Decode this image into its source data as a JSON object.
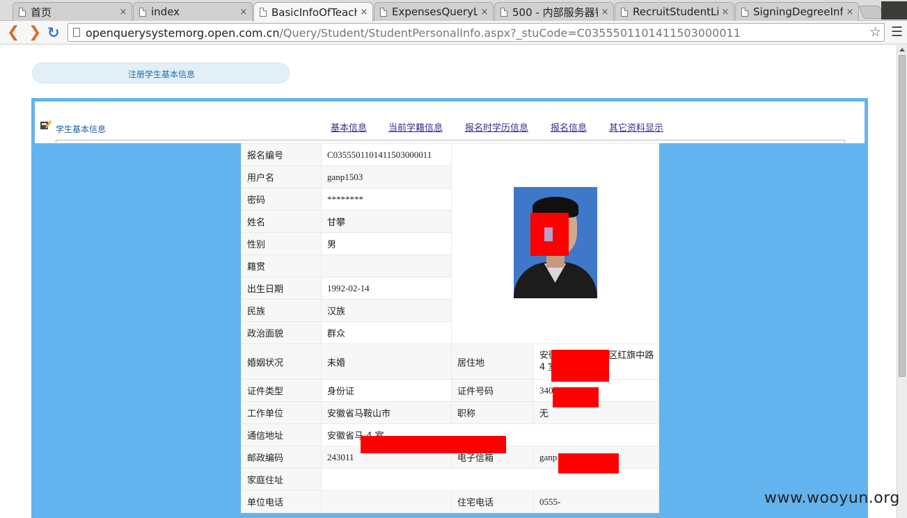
{
  "browser": {
    "tabs": [
      {
        "title": "首页",
        "active": false
      },
      {
        "title": "index",
        "active": false
      },
      {
        "title": "BasicInfoOfTeach",
        "active": true
      },
      {
        "title": "ExpensesQueryLi",
        "active": false
      },
      {
        "title": "500 - 内部服务器错",
        "active": false
      },
      {
        "title": "RecruitStudentLis",
        "active": false
      },
      {
        "title": "SigningDegreeInf",
        "active": false
      }
    ],
    "close_glyph": "×",
    "url_host": "openquerysystemorg.open.com.cn",
    "url_path": "/Query/Student/StudentPersonalInfo.aspx?_stuCode=C0355501101411503000011"
  },
  "page": {
    "register_link": "注册学生基本信息",
    "section_title": "学生基本信息",
    "tabs": [
      "基本信息",
      "当前学籍信息",
      "报名时学历信息",
      "报名信息",
      "其它资料显示"
    ]
  },
  "student": {
    "rows_top": [
      {
        "label": "报名编号",
        "value": "C0355501101411503000011"
      },
      {
        "label": "用户名",
        "value": "ganp1503"
      },
      {
        "label": "密码",
        "value": "********"
      },
      {
        "label": "姓名",
        "value": "甘攀"
      },
      {
        "label": "性别",
        "value": "男"
      },
      {
        "label": "籍贯",
        "value": ""
      },
      {
        "label": "出生日期",
        "value": "1992-02-14"
      },
      {
        "label": "民族",
        "value": "汉族"
      },
      {
        "label": "政治面貌",
        "value": "群众"
      }
    ],
    "rows_bottom": [
      {
        "label": "婚姻状况",
        "value": "未婚",
        "label2": "居住地",
        "value2": "安徽 马鞍山 雨山区红旗中路 4 室"
      },
      {
        "label": "证件类型",
        "value": "身份证",
        "label2": "证件号码",
        "value2": "340 40215"
      },
      {
        "label": "工作单位",
        "value": "安徽省马鞍山市",
        "label2": "职称",
        "value2": "无"
      },
      {
        "label": "通信地址",
        "value": "安徽省马 4 室"
      },
      {
        "label": "邮政编码",
        "value": "243011",
        "label2": "电子信箱",
        "value2": "ganp .cn"
      },
      {
        "label": "家庭住址",
        "value": ""
      },
      {
        "label": "单位电话",
        "value": "",
        "label2": "住宅电话",
        "value2": "0555-"
      }
    ]
  },
  "watermark": "www.wooyun.org",
  "colors": {
    "frame_blue": "#63b3ee",
    "redaction": "#ff0000",
    "link_purple": "#3b2a8c"
  }
}
